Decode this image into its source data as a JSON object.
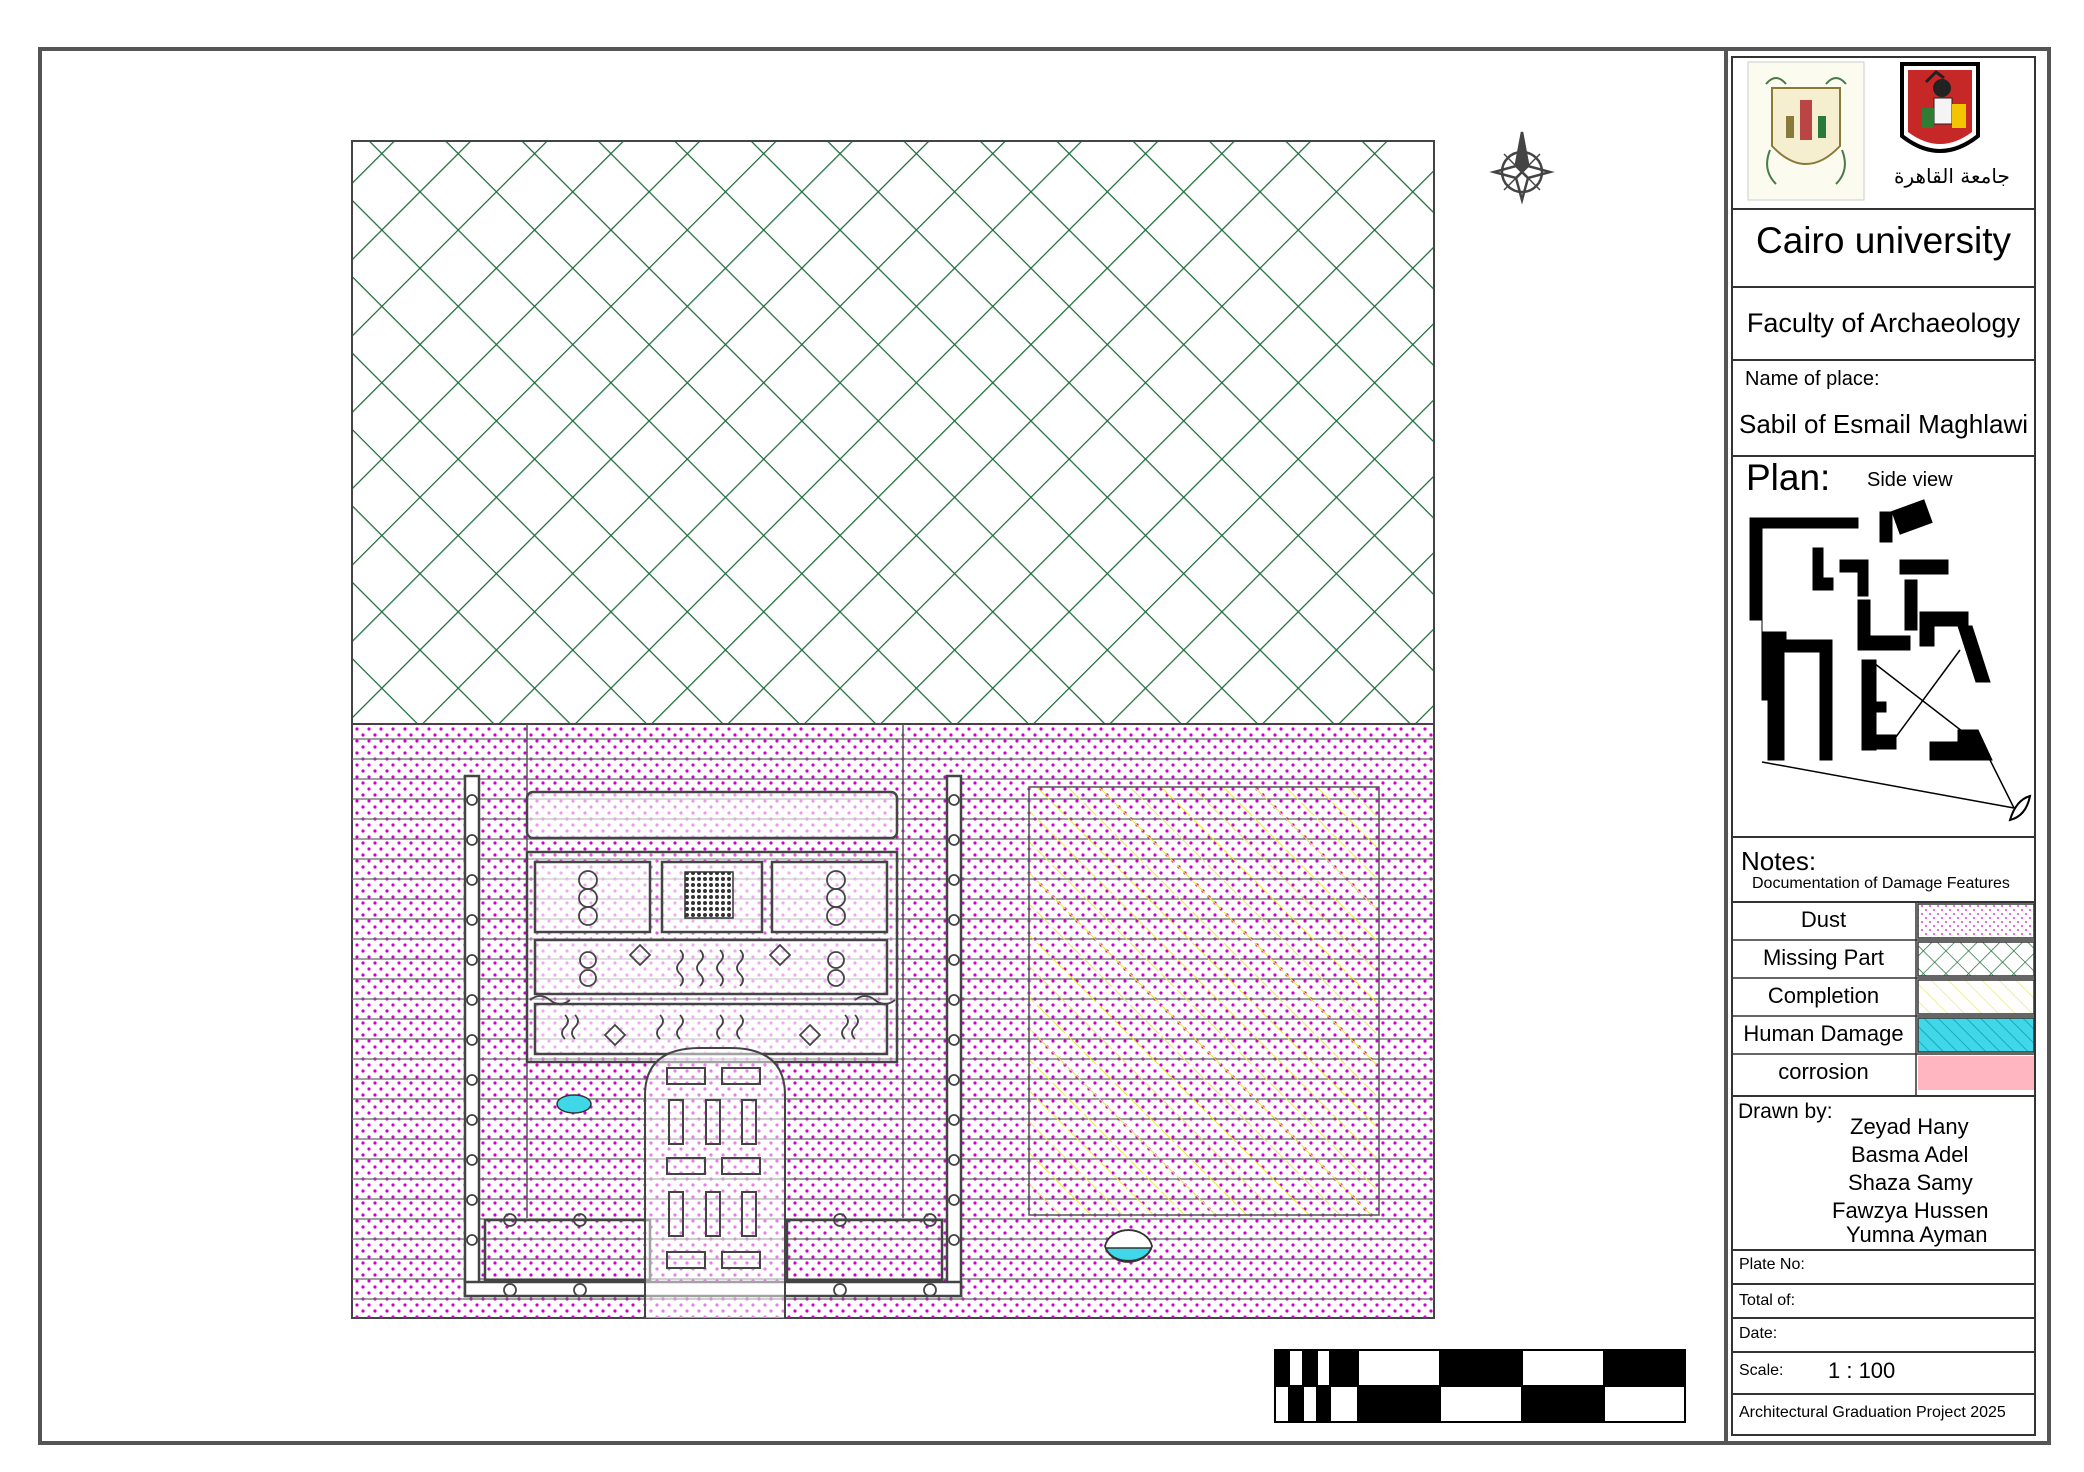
{
  "title_block": {
    "university": "Cairo university",
    "faculty": "Faculty of Archaeology",
    "name_label": "Name of place:",
    "place_name": "Sabil of Esmail Maghlawi",
    "plan_label": "Plan:",
    "view_label": "Side view",
    "notes_label": "Notes:",
    "notes_text": "Documentation of Damage Features",
    "legend": [
      {
        "label": "Dust",
        "pattern": "dots",
        "color": "#d000d0"
      },
      {
        "label": "Missing Part",
        "pattern": "crosshatch",
        "color": "#1e6b3a"
      },
      {
        "label": "Completion",
        "pattern": "diagonal",
        "color": "#f2f27a"
      },
      {
        "label": "Human Damage",
        "pattern": "diagonal-fill",
        "color": "#40d8e8"
      },
      {
        "label": "corrosion",
        "pattern": "solid",
        "color": "#ffb6c1"
      }
    ],
    "drawn_by_label": "Drawn by:",
    "drawn_by": [
      "Zeyad Hany",
      "Basma Adel",
      "Shaza Samy",
      "Fawzya Hussen",
      "Yumna Ayman"
    ],
    "plate_label": "Plate No:",
    "total_label": "Total of:",
    "date_label": "Date:",
    "scale_label": "Scale:",
    "scale_value": "1 : 100",
    "project": "Architectural Graduation Project 2025"
  },
  "logos": {
    "left": "faculty-crest",
    "right": "cairo-university-emblem",
    "right_caption": "جامعة القاهرة"
  },
  "colors": {
    "dust": "#d000d0",
    "missing": "#1e6b3a",
    "completion": "#f2f27a",
    "human_damage": "#40d8e8",
    "corrosion": "#ffb6c1",
    "linework": "#444444"
  },
  "icons": {
    "north": "north-arrow-icon"
  }
}
